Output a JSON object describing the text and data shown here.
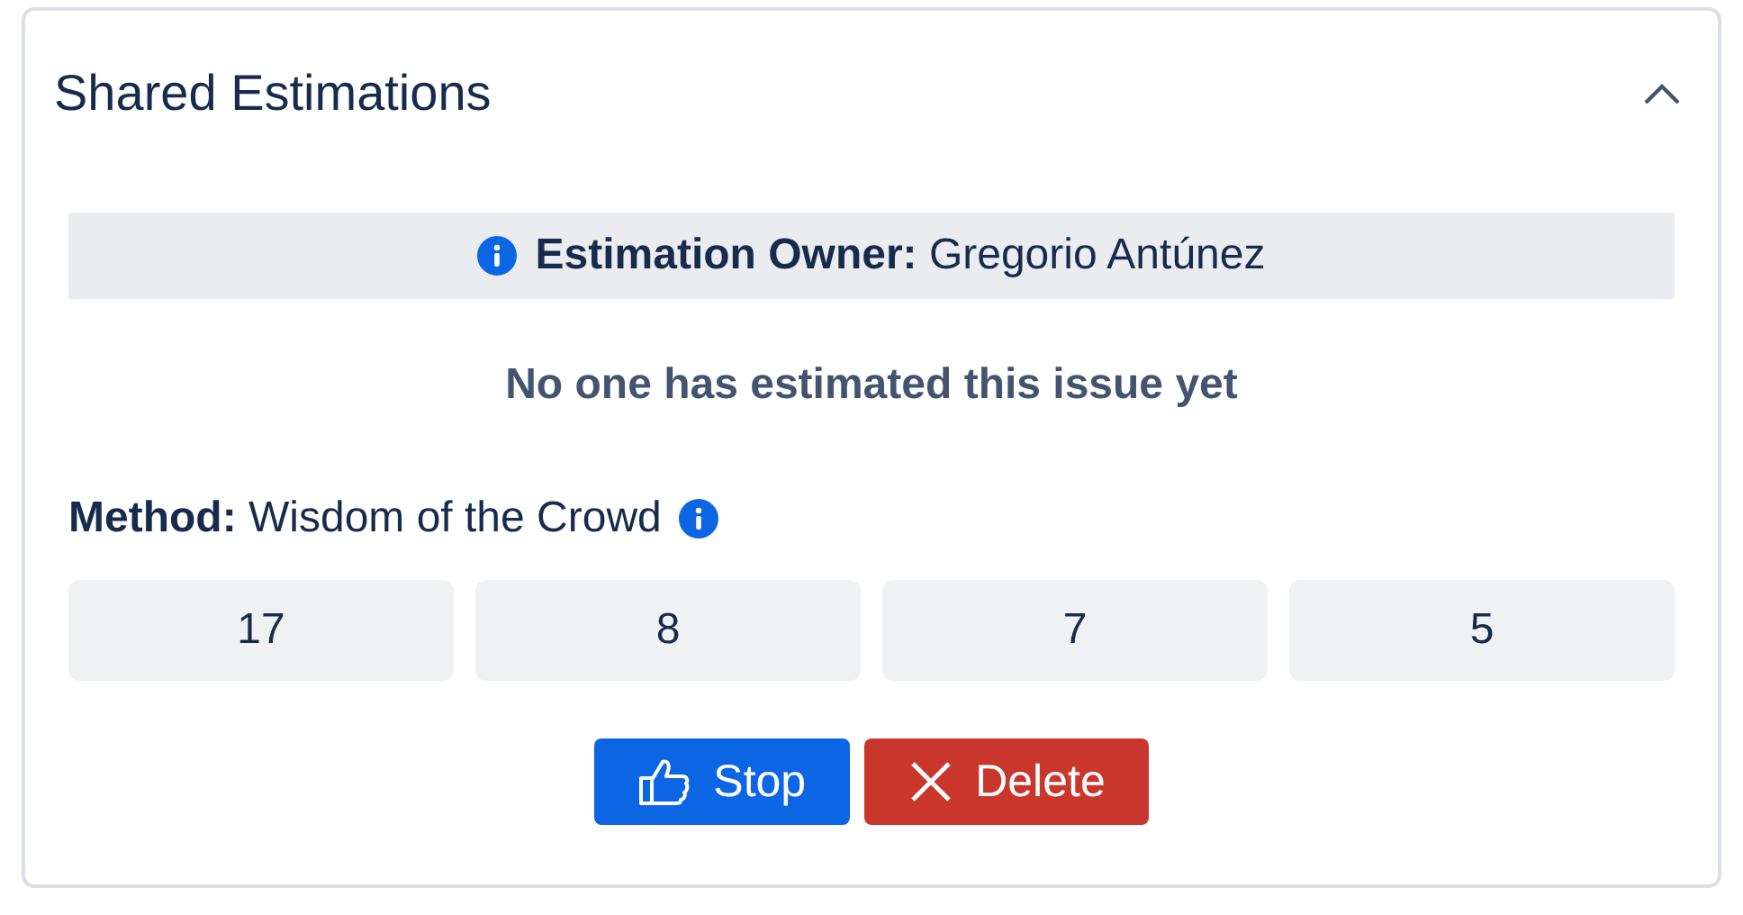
{
  "panel": {
    "title": "Shared Estimations",
    "expanded": true
  },
  "owner": {
    "text": "**Estimation Owner:** Gregorio Antúnez"
  },
  "message": "No one has estimated this issue yet",
  "method": {
    "text": "**Method:** Wisdom of the Crowd"
  },
  "estimates": [
    "17",
    "8",
    "7",
    "5"
  ],
  "buttons": [
    {
      "kind": "stop",
      "label": "Stop"
    },
    {
      "kind": "delete",
      "label": "Delete"
    }
  ]
}
